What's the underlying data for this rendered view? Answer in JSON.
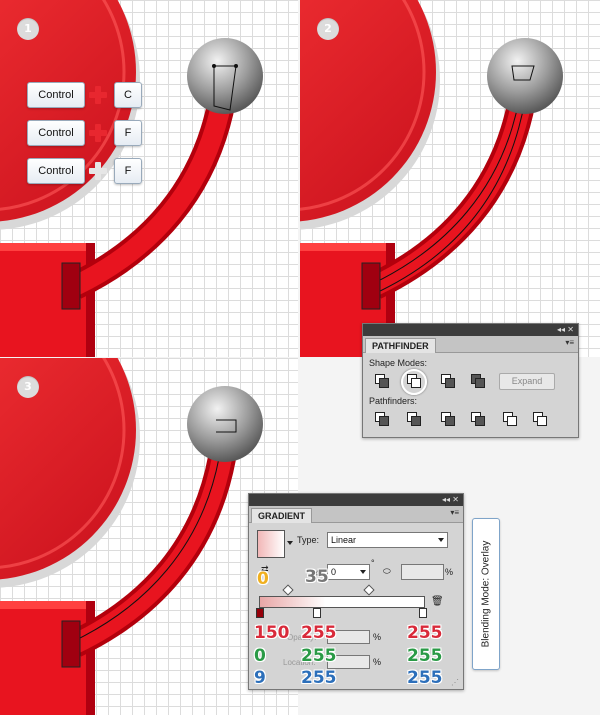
{
  "steps": [
    "1",
    "2",
    "3"
  ],
  "shortcuts": [
    {
      "modifier": "Control",
      "key": "C"
    },
    {
      "modifier": "Control",
      "key": "F"
    },
    {
      "modifier": "Control",
      "key": "F"
    }
  ],
  "pathfinder": {
    "title": "PATHFINDER",
    "shape_modes_label": "Shape Modes:",
    "pathfinders_label": "Pathfinders:",
    "expand_label": "Expand"
  },
  "gradient": {
    "title": "GRADIENT",
    "type_label": "Type:",
    "type_value": "Linear",
    "angle_value": "0",
    "angle_unit": "°",
    "aspect_unit": "%",
    "opacity_label": "Opacity:",
    "location_label": "Location:",
    "percent": "%",
    "callout_angle": "0",
    "callout_location": "35",
    "color_left": {
      "r": "150",
      "g": "0",
      "b": "9"
    },
    "color_mid": {
      "r": "255",
      "g": "255",
      "b": "255"
    },
    "color_right": {
      "r": "255",
      "g": "255",
      "b": "255"
    }
  },
  "blending_mode_label": "Blending Mode: Overlay",
  "colors": {
    "accent_red": "#e8272f",
    "deep_red": "#c8101c",
    "metal": "#9a9a9a"
  }
}
